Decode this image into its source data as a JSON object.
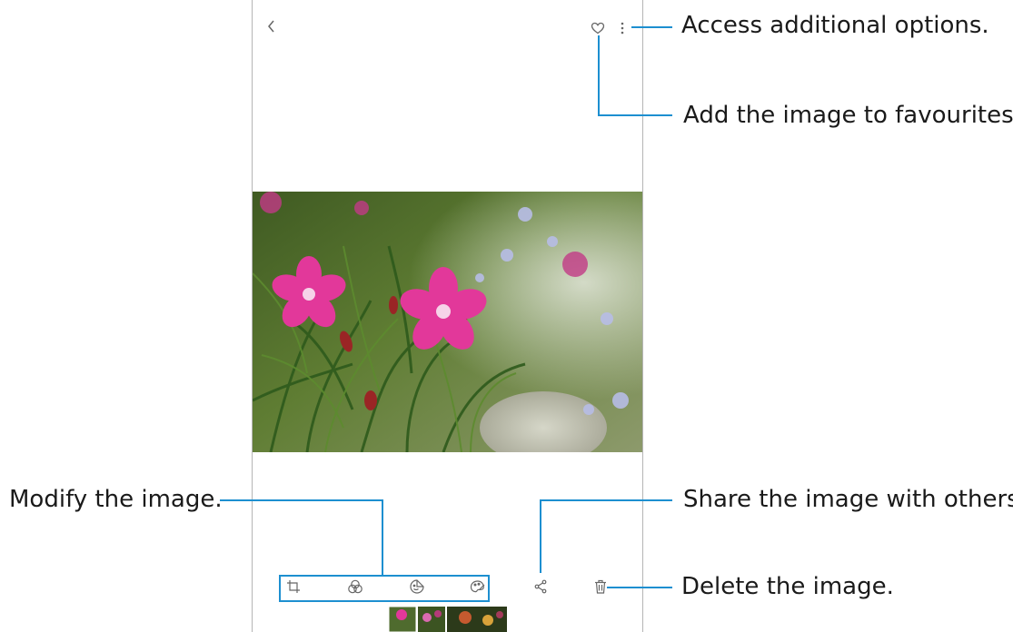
{
  "callouts": {
    "more_options": "Access additional options.",
    "favourite": "Add the image to favourites.",
    "modify": "Modify the image.",
    "share": "Share the image with others.",
    "delete": "Delete the image."
  },
  "icons": {
    "back": "chevron-left-icon",
    "favourite": "heart-outline-icon",
    "more": "more-vertical-icon",
    "crop": "crop-icon",
    "filter": "filter-icon",
    "sticker": "sticker-icon",
    "paint": "paint-brush-icon",
    "share": "share-icon",
    "delete": "trash-icon"
  },
  "colors": {
    "callout_line": "#1d8fd0",
    "icon": "#666666",
    "phone_border": "#b5b5b5",
    "flower": "#e2389a"
  }
}
